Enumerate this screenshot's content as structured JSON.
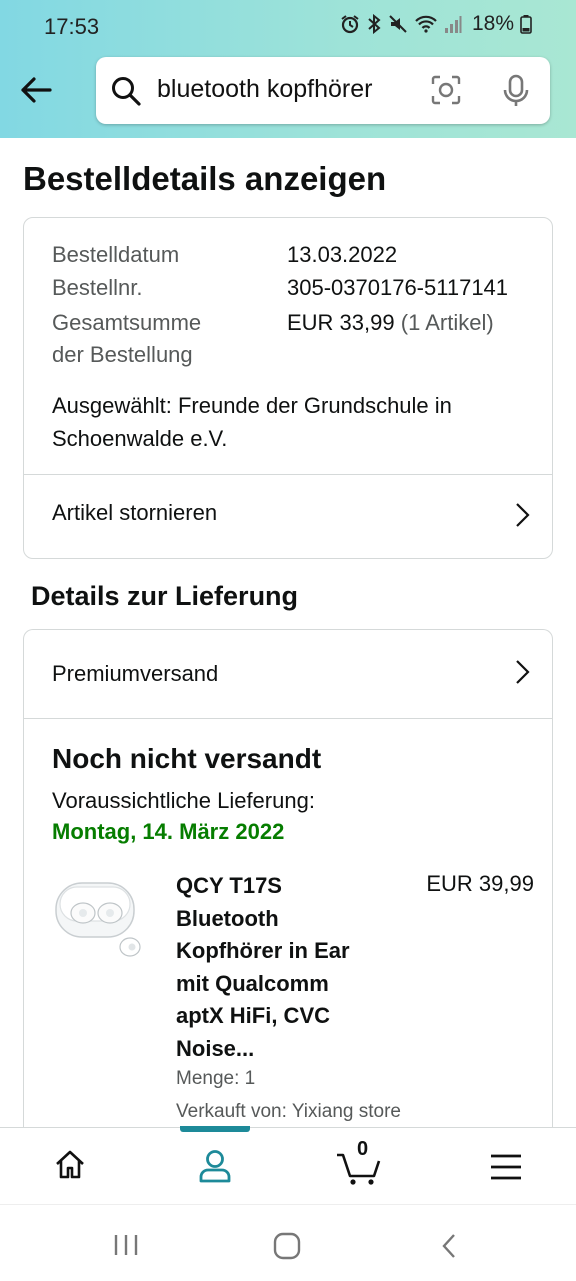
{
  "status_bar": {
    "time": "17:53",
    "battery": "18%"
  },
  "search": {
    "query": "bluetooth kopfhörer"
  },
  "page_title": "Bestelldetails anzeigen",
  "order": {
    "date_label": "Bestelldatum",
    "date_value": "13.03.2022",
    "number_label": "Bestellnr.",
    "number_value": "305-0370176-5117141",
    "total_label_1": "Gesamtsumme",
    "total_label_2": "der Bestellung",
    "total_value": "EUR 33,99",
    "total_items": "(1 Artikel)",
    "selected_line_1": "Ausgewählt: Freunde der Grundschule in",
    "selected_line_2": "Schoenwalde e.V.",
    "cancel_label": "Artikel stornieren"
  },
  "delivery": {
    "section_title": "Details zur Lieferung",
    "shipping_method": "Premiumversand",
    "status": "Noch nicht versandt",
    "eta_label": "Voraussichtliche Lieferung:",
    "eta_date": "Montag, 14. März 2022",
    "product": {
      "title_lines": [
        "QCY T17S",
        "Bluetooth",
        "Kopfhörer in Ear",
        "mit Qualcomm",
        "aptX HiFi, CVC",
        "Noise..."
      ],
      "price": "EUR 39,99",
      "quantity": "Menge: 1",
      "seller": "Verkauft von: Yixiang store"
    }
  },
  "bottom_nav": {
    "items": [
      "home-icon",
      "account-icon",
      "cart-icon",
      "menu-icon"
    ],
    "cart_count": "0",
    "accent": "#1d8a99"
  },
  "colors": {
    "eta_green": "#067d00",
    "header_start": "#82d8e3",
    "header_end": "#a9e7d3"
  }
}
